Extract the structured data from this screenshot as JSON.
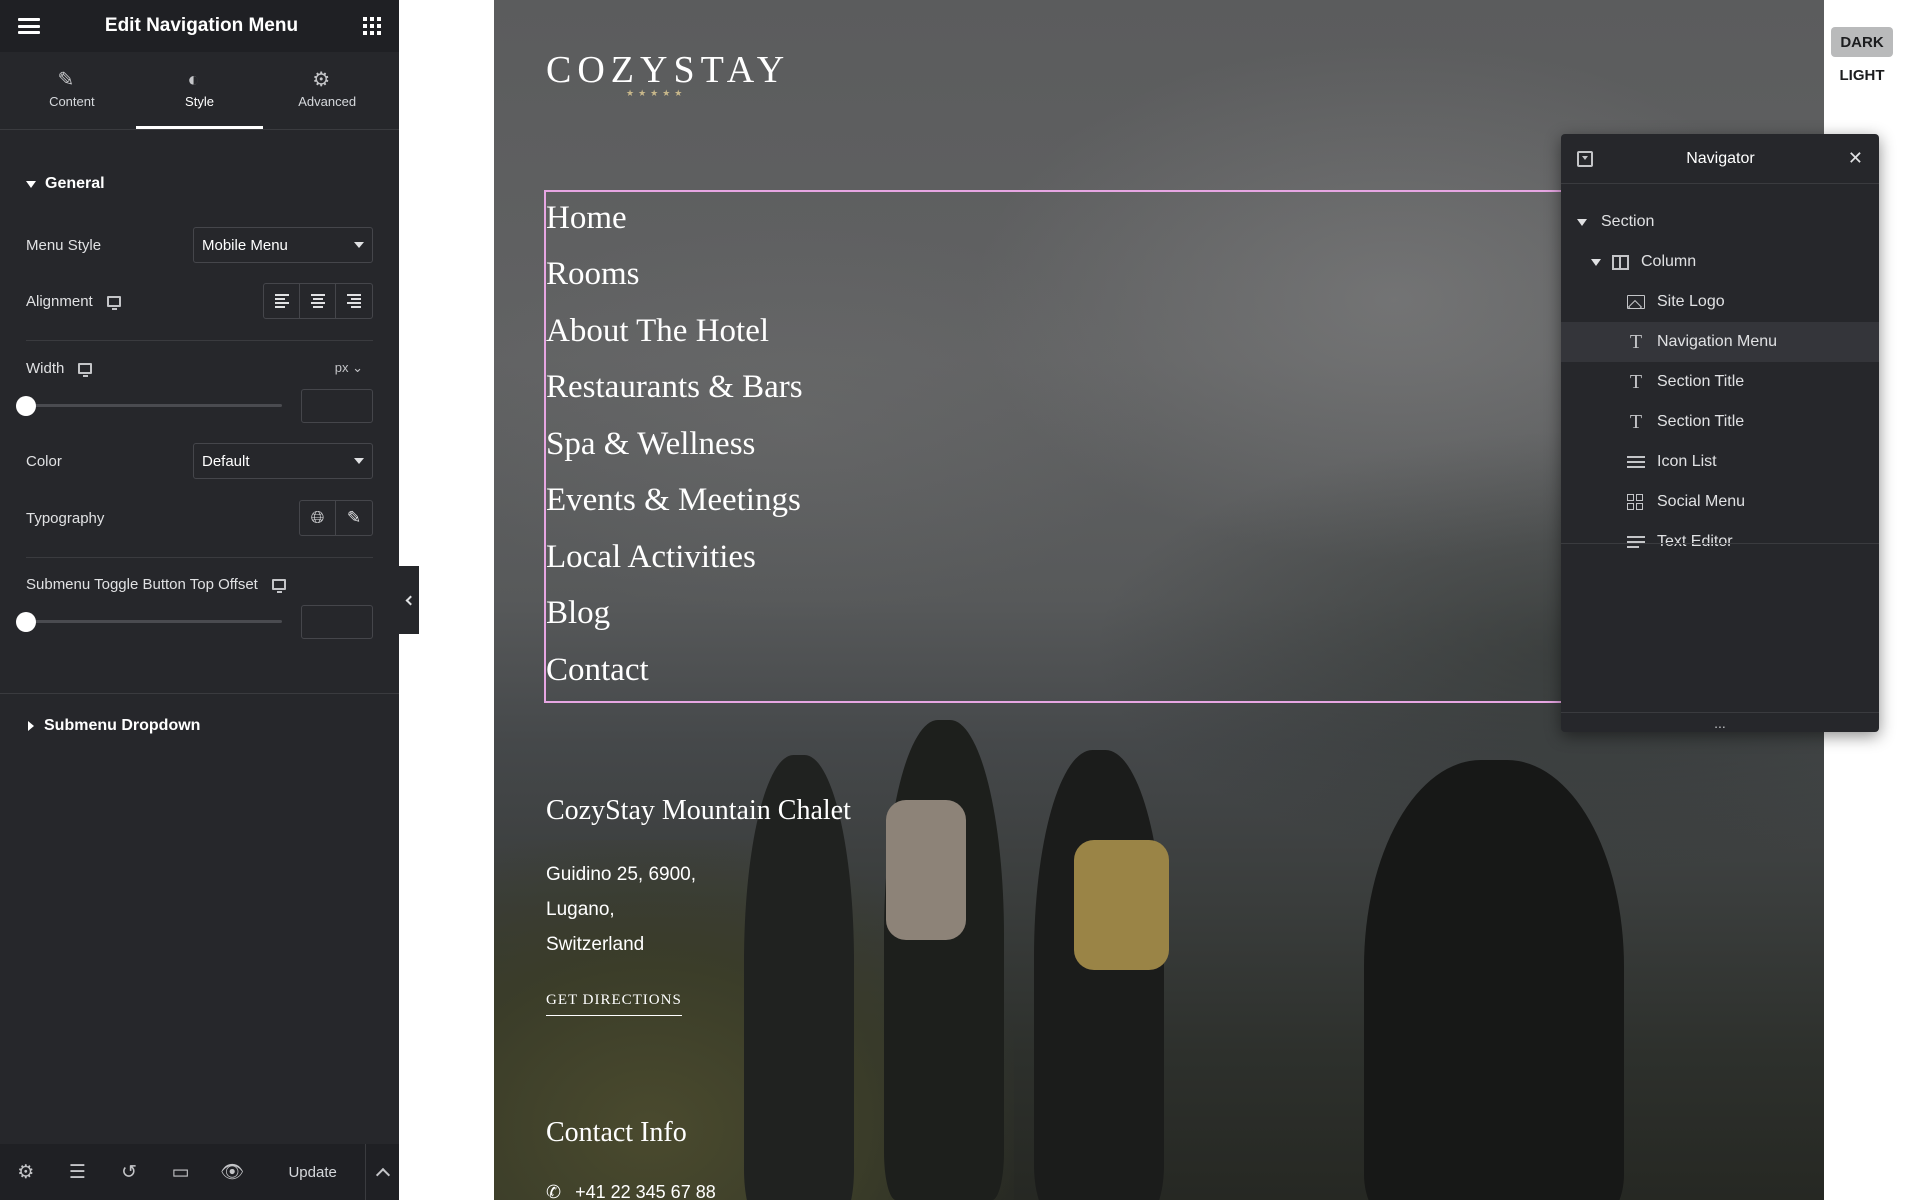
{
  "panel": {
    "title": "Edit Navigation Menu",
    "tabs": [
      {
        "label": "Content",
        "icon": "pencil-icon"
      },
      {
        "label": "Style",
        "icon": "contrast-icon"
      },
      {
        "label": "Advanced",
        "icon": "gear-icon"
      }
    ],
    "active_tab": "Style",
    "general_section": {
      "title": "General",
      "menu_style_label": "Menu Style",
      "menu_style_value": "Mobile Menu",
      "alignment_label": "Alignment",
      "width_label": "Width",
      "width_unit": "px",
      "width_value": "",
      "color_label": "Color",
      "color_value": "Default",
      "typography_label": "Typography",
      "submenu_offset_label": "Submenu Toggle Button Top Offset",
      "submenu_offset_value": ""
    },
    "submenu_section_title": "Submenu Dropdown",
    "footer": {
      "update_label": "Update"
    }
  },
  "preview": {
    "logo": "COZYSTAY",
    "logo_stars": "★★★★★",
    "nav_items": [
      "Home",
      "Rooms",
      "About The Hotel",
      "Restaurants & Bars",
      "Spa & Wellness",
      "Events & Meetings",
      "Local Activities",
      "Blog",
      "Contact"
    ],
    "chalet_title": "CozyStay Mountain Chalet",
    "address": [
      "Guidino 25, 6900,",
      "Lugano,",
      "Switzerland"
    ],
    "directions_label": "GET DIRECTIONS",
    "contact_title": "Contact Info",
    "phone": "+41 22 345 67 88"
  },
  "theme_toggle": {
    "dark_label": "DARK",
    "light_label": "LIGHT"
  },
  "navigator": {
    "title": "Navigator",
    "tree": [
      {
        "label": "Section",
        "icon": "caret-down-icon",
        "level": 0
      },
      {
        "label": "Column",
        "icon": "column-icon",
        "level": 1
      },
      {
        "label": "Site Logo",
        "icon": "image-icon",
        "level": 2
      },
      {
        "label": "Navigation Menu",
        "icon": "text-icon",
        "level": 2,
        "selected": true
      },
      {
        "label": "Section Title",
        "icon": "text-icon",
        "level": 2
      },
      {
        "label": "Section Title",
        "icon": "text-icon",
        "level": 2
      },
      {
        "label": "Icon List",
        "icon": "list-icon",
        "level": 2
      },
      {
        "label": "Social Menu",
        "icon": "grid-icon",
        "level": 2
      },
      {
        "label": "Text Editor",
        "icon": "paragraph-icon",
        "level": 2
      }
    ],
    "footer_glyph": "..."
  },
  "colors": {
    "panel_bg": "#26272b",
    "nav_highlight": "#e7a6e3",
    "logo_stars": "#c8b88a"
  }
}
